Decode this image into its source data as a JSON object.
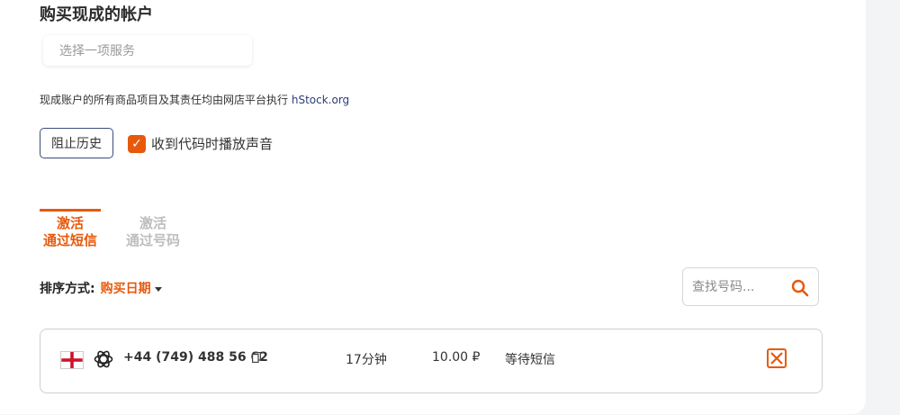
{
  "page": {
    "title": "购买现成的帐户"
  },
  "service_select": {
    "placeholder": "选择一项服务"
  },
  "notice": {
    "text": "现成账户的所有商品项目及其责任均由网店平台执行",
    "link": "hStock.org"
  },
  "controls": {
    "history_button": "阻止历史",
    "sound_checkbox_label": "收到代码时播放声音",
    "sound_checked": true
  },
  "tabs": [
    {
      "line1": "激活",
      "line2": "通过短信",
      "active": true
    },
    {
      "line1": "激活",
      "line2": "通过号码",
      "active": false
    }
  ],
  "sort": {
    "label": "排序方式:",
    "value": "购买日期"
  },
  "search": {
    "placeholder": "查找号码..."
  },
  "orders": [
    {
      "country_flag": "england-flag-icon",
      "service_icon": "openai-icon",
      "phone": "+44 (749) 488 56 62",
      "time": "17分钟",
      "price": "10.00 ₽",
      "status": "等待短信"
    }
  ],
  "colors": {
    "accent": "#e8590c",
    "navy": "#2c3d78",
    "border": "#cfcfcf"
  }
}
